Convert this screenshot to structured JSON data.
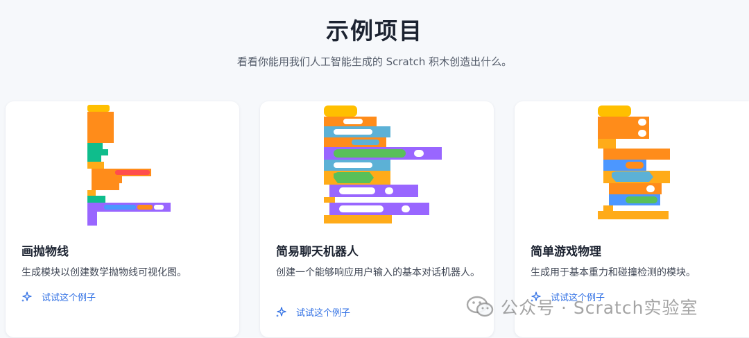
{
  "header": {
    "title": "示例项目",
    "subtitle": "看看你能用我们人工智能生成的 Scratch 积木创造出什么。"
  },
  "cards": [
    {
      "title": "画抛物线",
      "description": "生成模块以创建数学抛物线可视化图。",
      "link_label": "试试这个例子",
      "icon": "sparkle-icon"
    },
    {
      "title": "简易聊天机器人",
      "description": "创建一个能够响应用户输入的基本对话机器人。",
      "link_label": "试试这个例子",
      "icon": "sparkle-icon"
    },
    {
      "title": "简单游戏物理",
      "description": "生成用于基本重力和碰撞检测的模块。",
      "link_label": "试试这个例子",
      "icon": "sparkle-icon"
    }
  ],
  "watermark": {
    "text": "公众号 · Scratch实验室",
    "icon": "wechat-logo-icon"
  },
  "colors": {
    "accent": "#2f6fe4",
    "block_events": "#ffbf00",
    "block_variables": "#ff8c1a",
    "block_looks": "#9966ff",
    "block_sensing": "#5cb1d6",
    "block_operators": "#59c059",
    "block_control": "#ffab19",
    "block_motion": "#4c97ff",
    "block_pen": "#0fbd8c"
  }
}
